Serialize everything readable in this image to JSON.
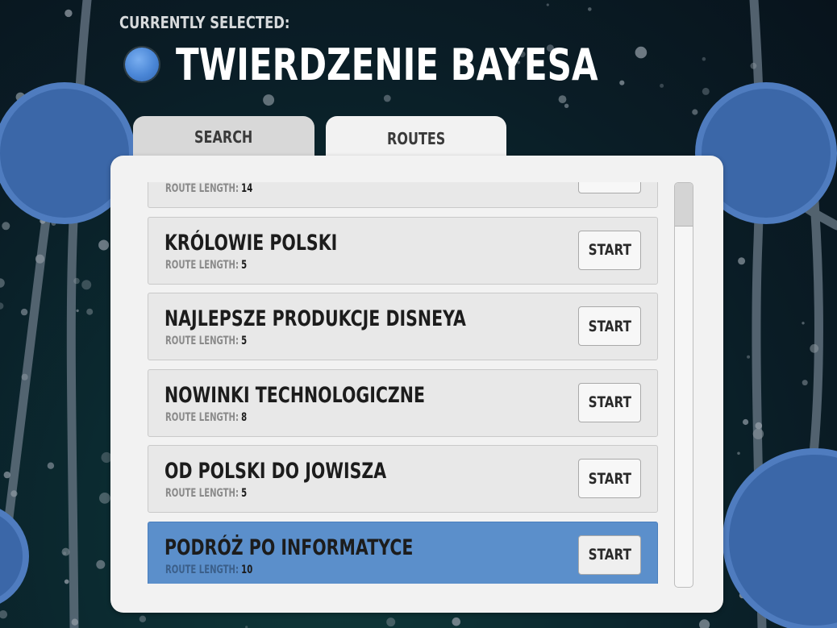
{
  "header": {
    "currently_selected_label": "CURRENTLY SELECTED:",
    "selected_node_title": "TWIERDZENIE BAYESA"
  },
  "tabs": [
    {
      "label": "SEARCH",
      "active": false
    },
    {
      "label": "ROUTES",
      "active": true
    }
  ],
  "routes": {
    "length_label": "ROUTE LENGTH:",
    "start_label": "START",
    "items": [
      {
        "name": "",
        "length": "14"
      },
      {
        "name": "KRÓLOWIE POLSKI",
        "length": "5"
      },
      {
        "name": "NAJLEPSZE PRODUKCJE DISNEYA",
        "length": "5"
      },
      {
        "name": "NOWINKI TECHNOLOGICZNE",
        "length": "8"
      },
      {
        "name": "OD POLSKI DO JOWISZA",
        "length": "5"
      },
      {
        "name": "PODRÓŻ PO INFORMATYCE",
        "length": "10",
        "selected": true
      }
    ]
  },
  "colors": {
    "selected_row": "#5b8fcb",
    "node_blue": "#4a86d6",
    "panel_bg": "#f2f2f2",
    "background": "#0a1d26"
  },
  "icons": {
    "selected_dot": "selected-node-dot-icon"
  }
}
